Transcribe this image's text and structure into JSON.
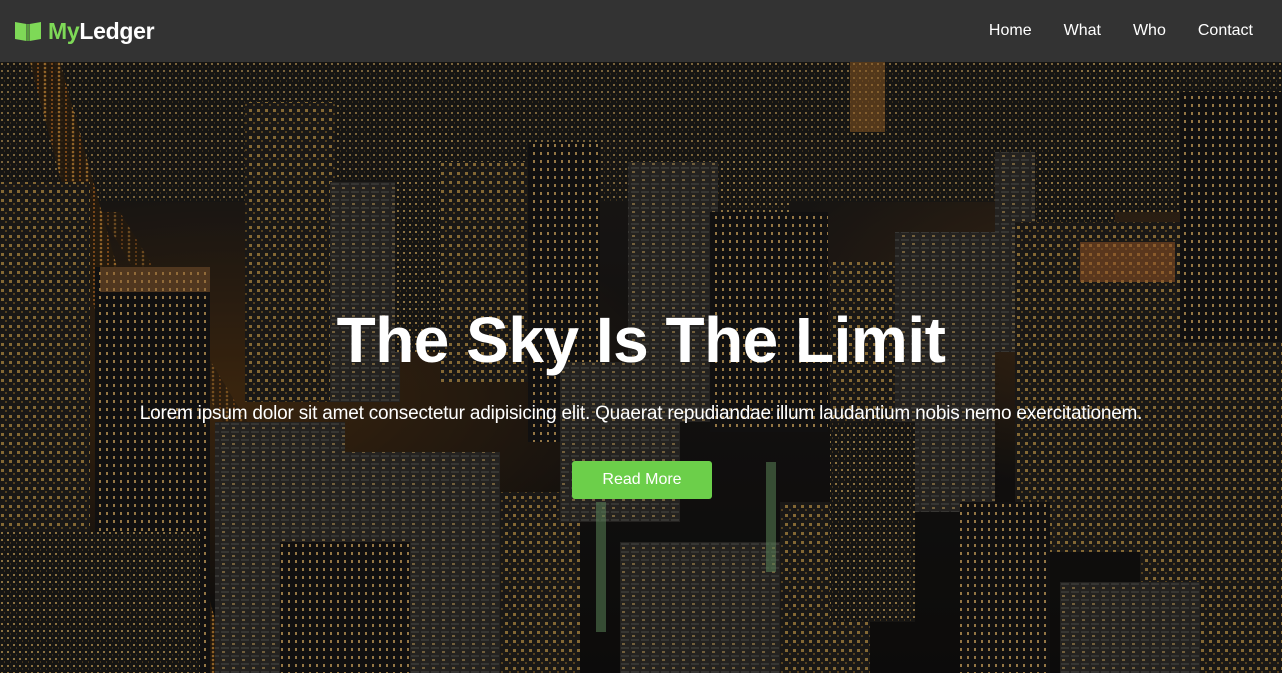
{
  "nav": {
    "brand": {
      "icon": "open-book-icon",
      "part1": "My",
      "part2": "Ledger"
    },
    "links": [
      "Home",
      "What",
      "Who",
      "Contact"
    ]
  },
  "hero": {
    "background": "night-city-aerial-photo",
    "title": "The Sky Is The Limit",
    "text": "Lorem ipsum dolor sit amet consectetur adipisicing elit. Quaerat repudiandae illum laudantium nobis nemo exercitationem.",
    "button_label": "Read More"
  },
  "colors": {
    "navbar": "#333333",
    "brand_green": "#7ed957",
    "button_green": "#6ccf4a",
    "text": "#ffffff"
  }
}
